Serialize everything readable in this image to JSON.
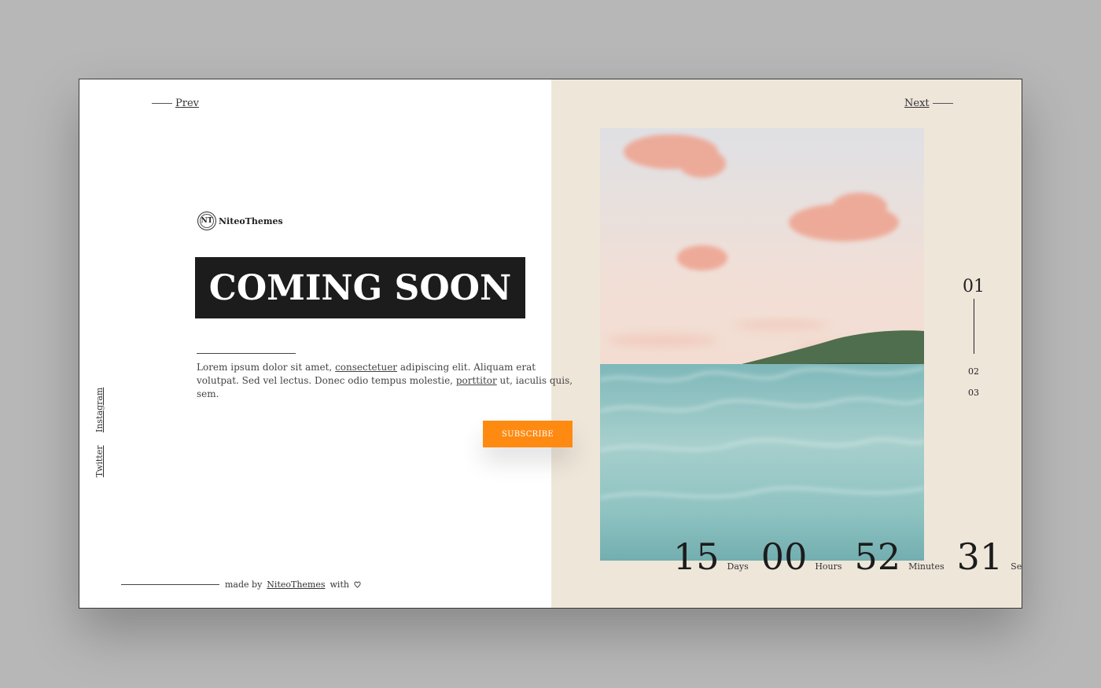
{
  "nav": {
    "prev_label": "Prev",
    "next_label": "Next"
  },
  "brand": {
    "mark": "NT",
    "name": "NiteoThemes"
  },
  "hero": {
    "headline": "COMING SOON",
    "lead_part1": "Lorem ipsum dolor sit amet, ",
    "lead_link1": "consectetuer",
    "lead_part2": " adipiscing elit. Aliquam erat volutpat. Sed vel lectus. Donec odio tempus molestie, ",
    "lead_link2": "porttitor",
    "lead_part3": " ut, iaculis quis, sem.",
    "subscribe_label": "SUBSCRIBE"
  },
  "social": {
    "instagram": "Instagram",
    "twitter": "Twitter"
  },
  "footer": {
    "made_by": "made by",
    "link": "NiteoThemes",
    "with": "with"
  },
  "pager": {
    "current": "01",
    "items": [
      "02",
      "03"
    ]
  },
  "countdown": [
    {
      "value": "15",
      "unit": "Days"
    },
    {
      "value": "00",
      "unit": "Hours"
    },
    {
      "value": "52",
      "unit": "Minutes"
    },
    {
      "value": "31",
      "unit": "Seconds"
    }
  ],
  "colors": {
    "accent": "#ff8a12",
    "panel": "#efe6da",
    "headline_bg": "#1c1c1c"
  }
}
